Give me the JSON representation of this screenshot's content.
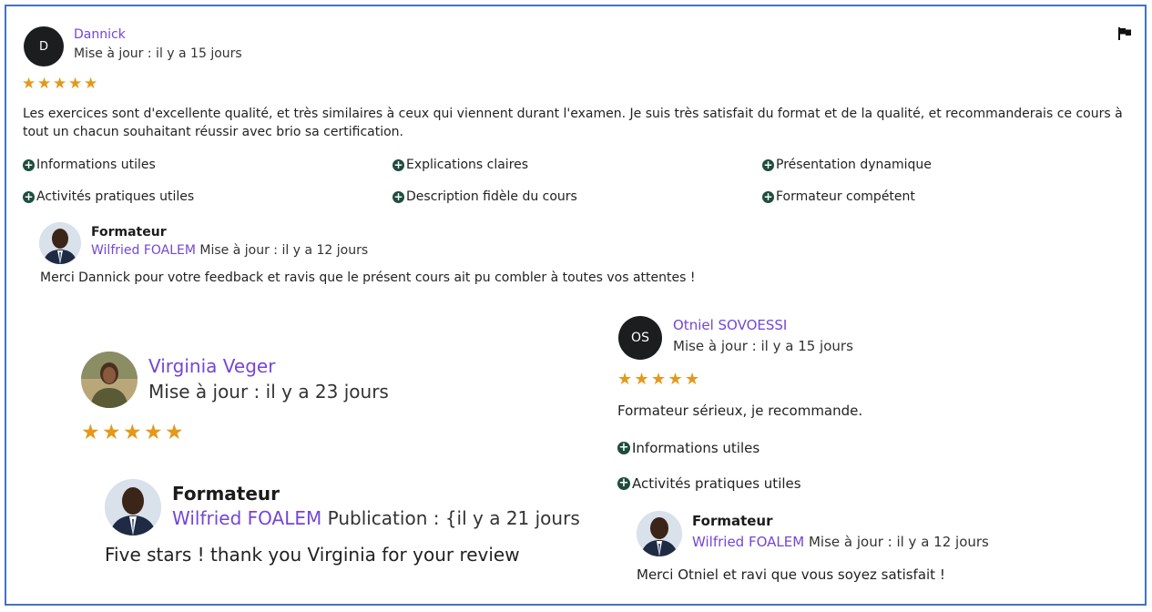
{
  "review1": {
    "avatar_initial": "D",
    "name": "Dannick",
    "updated": "Mise à jour : il y a 15 jours",
    "stars": 5,
    "text": "Les exercices sont d'excellente qualité, et très similaires à ceux qui viennent durant l'examen. Je suis très satisfait du format et de la qualité, et recommanderais ce cours à tout un chacun souhaitant réussir avec brio sa certification.",
    "tags": [
      "Informations utiles",
      "Explications claires",
      "Présentation dynamique",
      "Activités pratiques utiles",
      "Description fidèle du cours",
      "Formateur compétent"
    ],
    "reply": {
      "role": "Formateur",
      "name": "Wilfried FOALEM",
      "updated": "Mise à jour : il y a 12 jours",
      "text": "Merci Dannick pour votre feedback et ravis que le présent cours ait pu combler à toutes vos attentes !"
    }
  },
  "review2": {
    "name": "Virginia Veger",
    "updated": "Mise à jour : il y a 23 jours",
    "stars": 5,
    "reply": {
      "role": "Formateur",
      "name": "Wilfried FOALEM",
      "updated": "Publication : {il y a 21 jours",
      "text": "Five stars ! thank you Virginia for your review"
    }
  },
  "review3": {
    "avatar_initial": "OS",
    "name": "Otniel SOVOESSI",
    "updated": "Mise à jour : il y a 15 jours",
    "stars": 5,
    "text": "Formateur sérieux, je recommande.",
    "tags": [
      "Informations utiles",
      "Activités pratiques utiles"
    ],
    "reply": {
      "role": "Formateur",
      "name": "Wilfried FOALEM",
      "updated": "Mise à jour : il y a 12 jours",
      "text": "Merci Otniel et ravi que vous soyez satisfait !"
    }
  },
  "icons": {
    "flag": "flag-icon",
    "star": "star-icon",
    "plus": "plus-circle-icon"
  },
  "colors": {
    "name": "#7446d6",
    "star": "#e59819",
    "plus": "#1e4d3f",
    "frame": "#4472c4",
    "avatar": "#1c1d1f"
  }
}
